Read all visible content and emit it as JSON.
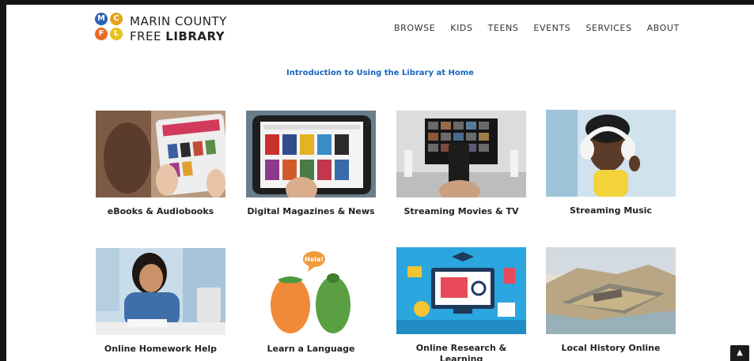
{
  "logo": {
    "letters": [
      "M",
      "C",
      "F",
      "L"
    ],
    "line1": "MARIN COUNTY",
    "line2_a": "FREE ",
    "line2_b": "LIBRARY",
    "colors": [
      "#2a62b5",
      "#e8a21d",
      "#ea6a25",
      "#e8c21d"
    ]
  },
  "nav": {
    "items": [
      "BROWSE",
      "KIDS",
      "TEENS",
      "EVENTS",
      "SERVICES",
      "ABOUT"
    ]
  },
  "intro_link": "Introduction to Using the Library at Home",
  "tiles": [
    {
      "label": "eBooks & Audiobooks"
    },
    {
      "label": "Digital Magazines & News"
    },
    {
      "label": "Streaming Movies & TV"
    },
    {
      "label": "Streaming Music"
    },
    {
      "label": "Online Homework Help"
    },
    {
      "label": "Learn a Language",
      "bubble": "Hola!"
    },
    {
      "label": "Online Research & Learning"
    },
    {
      "label": "Local History Online"
    }
  ],
  "scroll_top_icon": "chevron-up-icon"
}
